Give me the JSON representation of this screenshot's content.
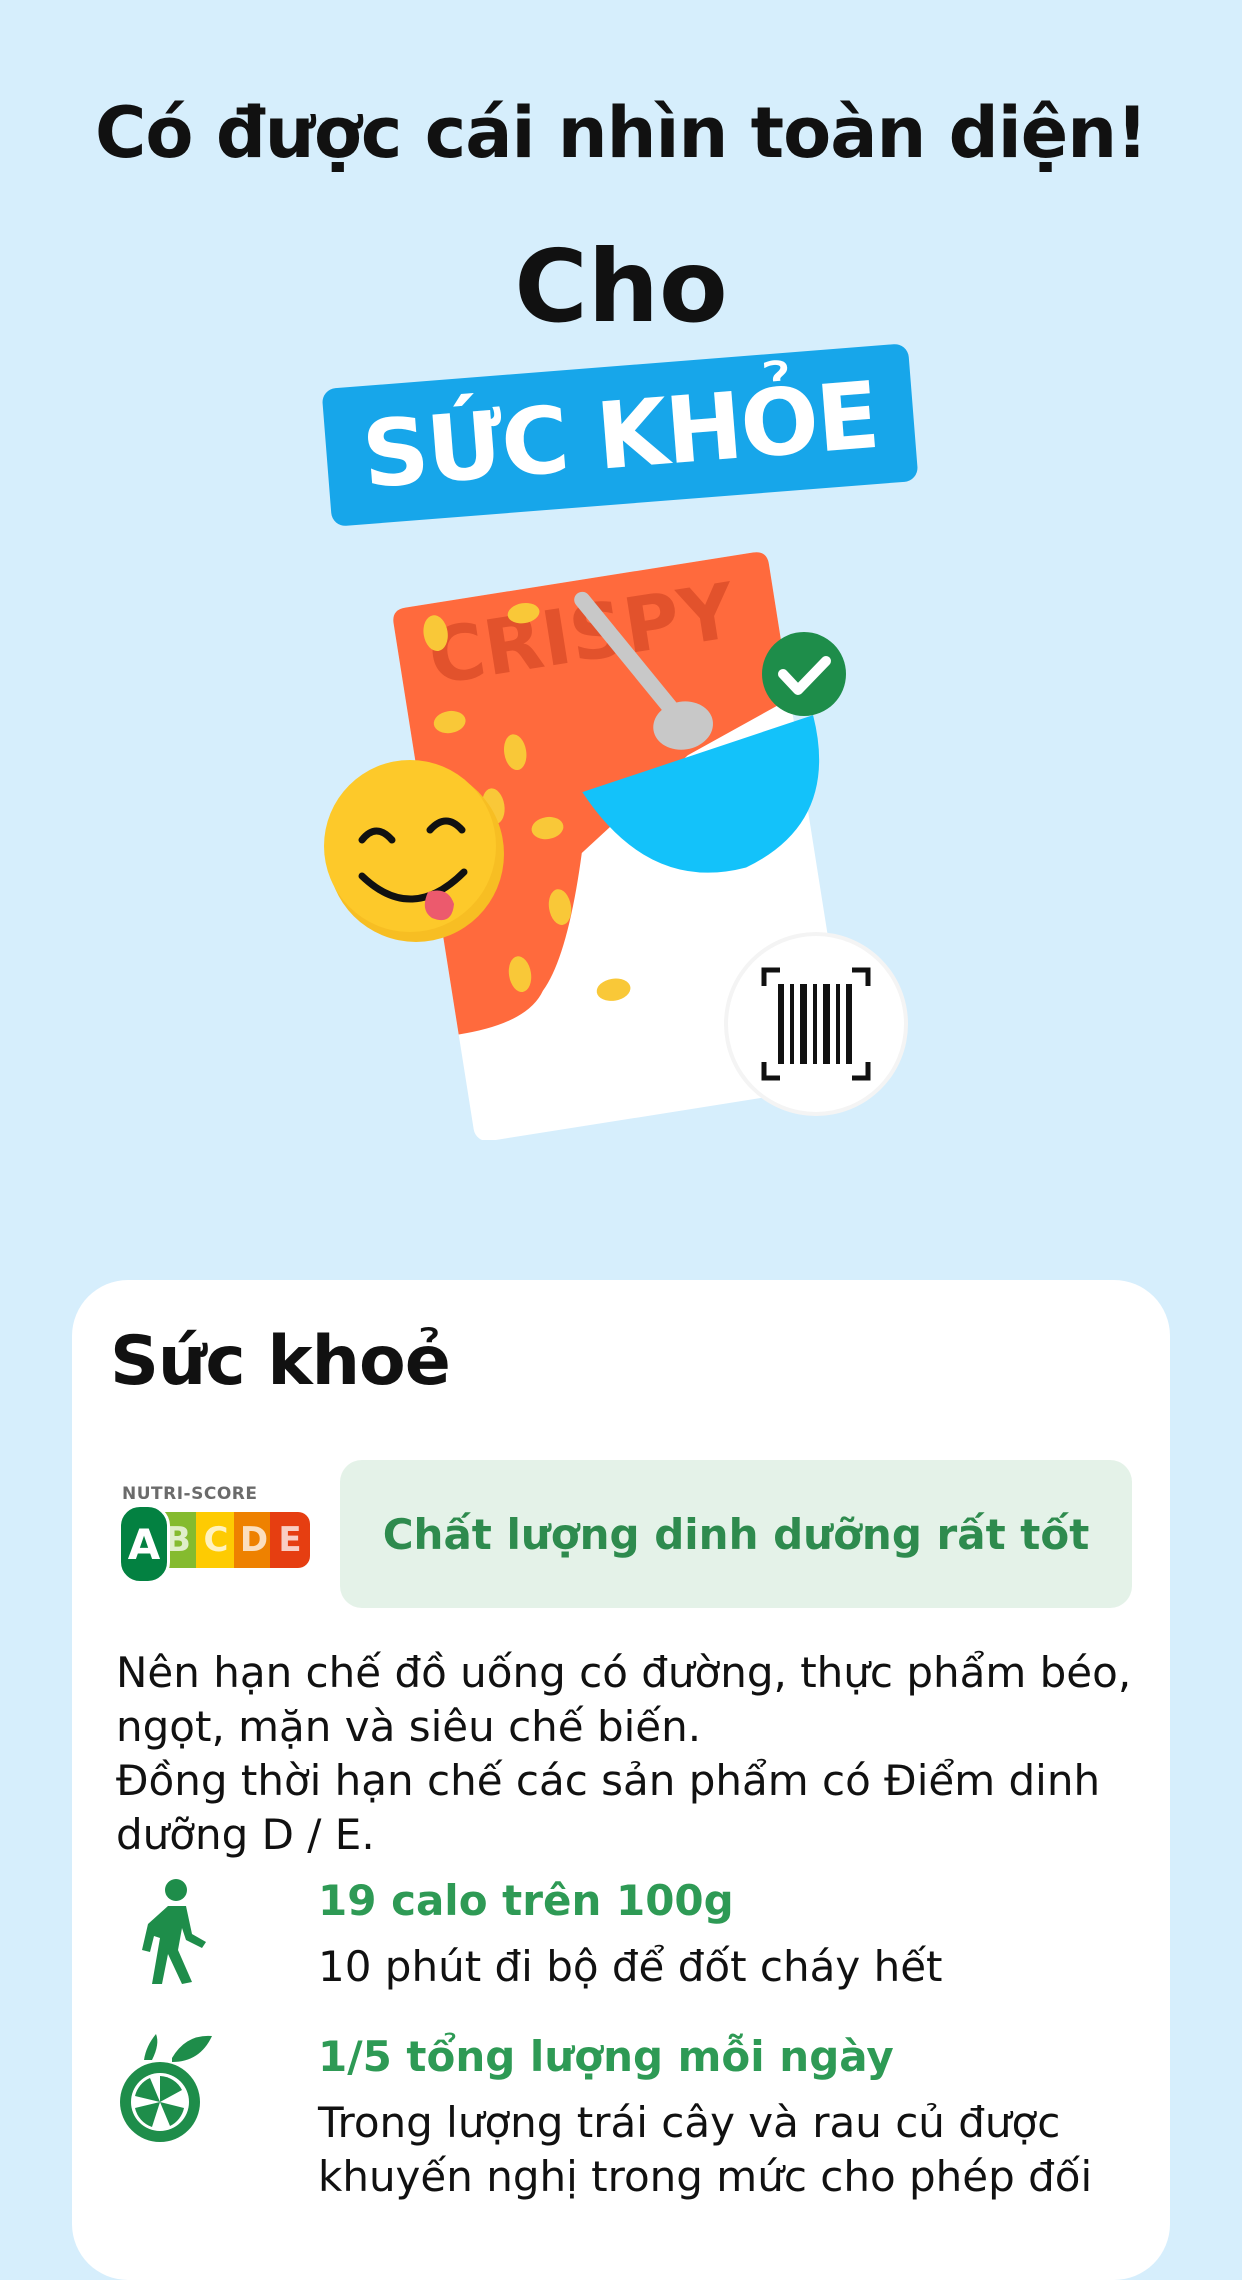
{
  "headline": "Có được cái nhìn toàn diện!",
  "subheadline": "Cho",
  "badge": "SỨC KHỎE",
  "illustration": {
    "package_text": "CRISPY",
    "icons": [
      "smiley-icon",
      "check-icon",
      "barcode-icon"
    ]
  },
  "card": {
    "title": "Sức khoẻ",
    "nutri_score": {
      "label": "NUTRI-SCORE",
      "grades": [
        "A",
        "B",
        "C",
        "D",
        "E"
      ],
      "selected": "A"
    },
    "quality_text": "Chất lượng dinh dưỡng rất tốt",
    "advice_lines": [
      "Nên hạn chế đồ uống có đường, thực phẩm béo,",
      "ngọt, mặn và siêu chế biến.",
      "Đồng thời hạn chế các sản phẩm có Điểm dinh",
      "dưỡng D / E."
    ],
    "facts": [
      {
        "icon": "walking-person-icon",
        "title": "19 calo trên 100g",
        "desc": "10 phút đi bộ để đốt cháy hết"
      },
      {
        "icon": "orange-fruit-icon",
        "title": "1/5 tổng lượng mỗi ngày",
        "desc": "Trong lượng trái cây và rau củ được khuyến nghị trong mức cho phép đối"
      }
    ]
  },
  "colors": {
    "background": "#d6eefc",
    "badge": "#17a6ea",
    "accent_green": "#2e9a55",
    "quality_bg": "#e4f2e8"
  }
}
